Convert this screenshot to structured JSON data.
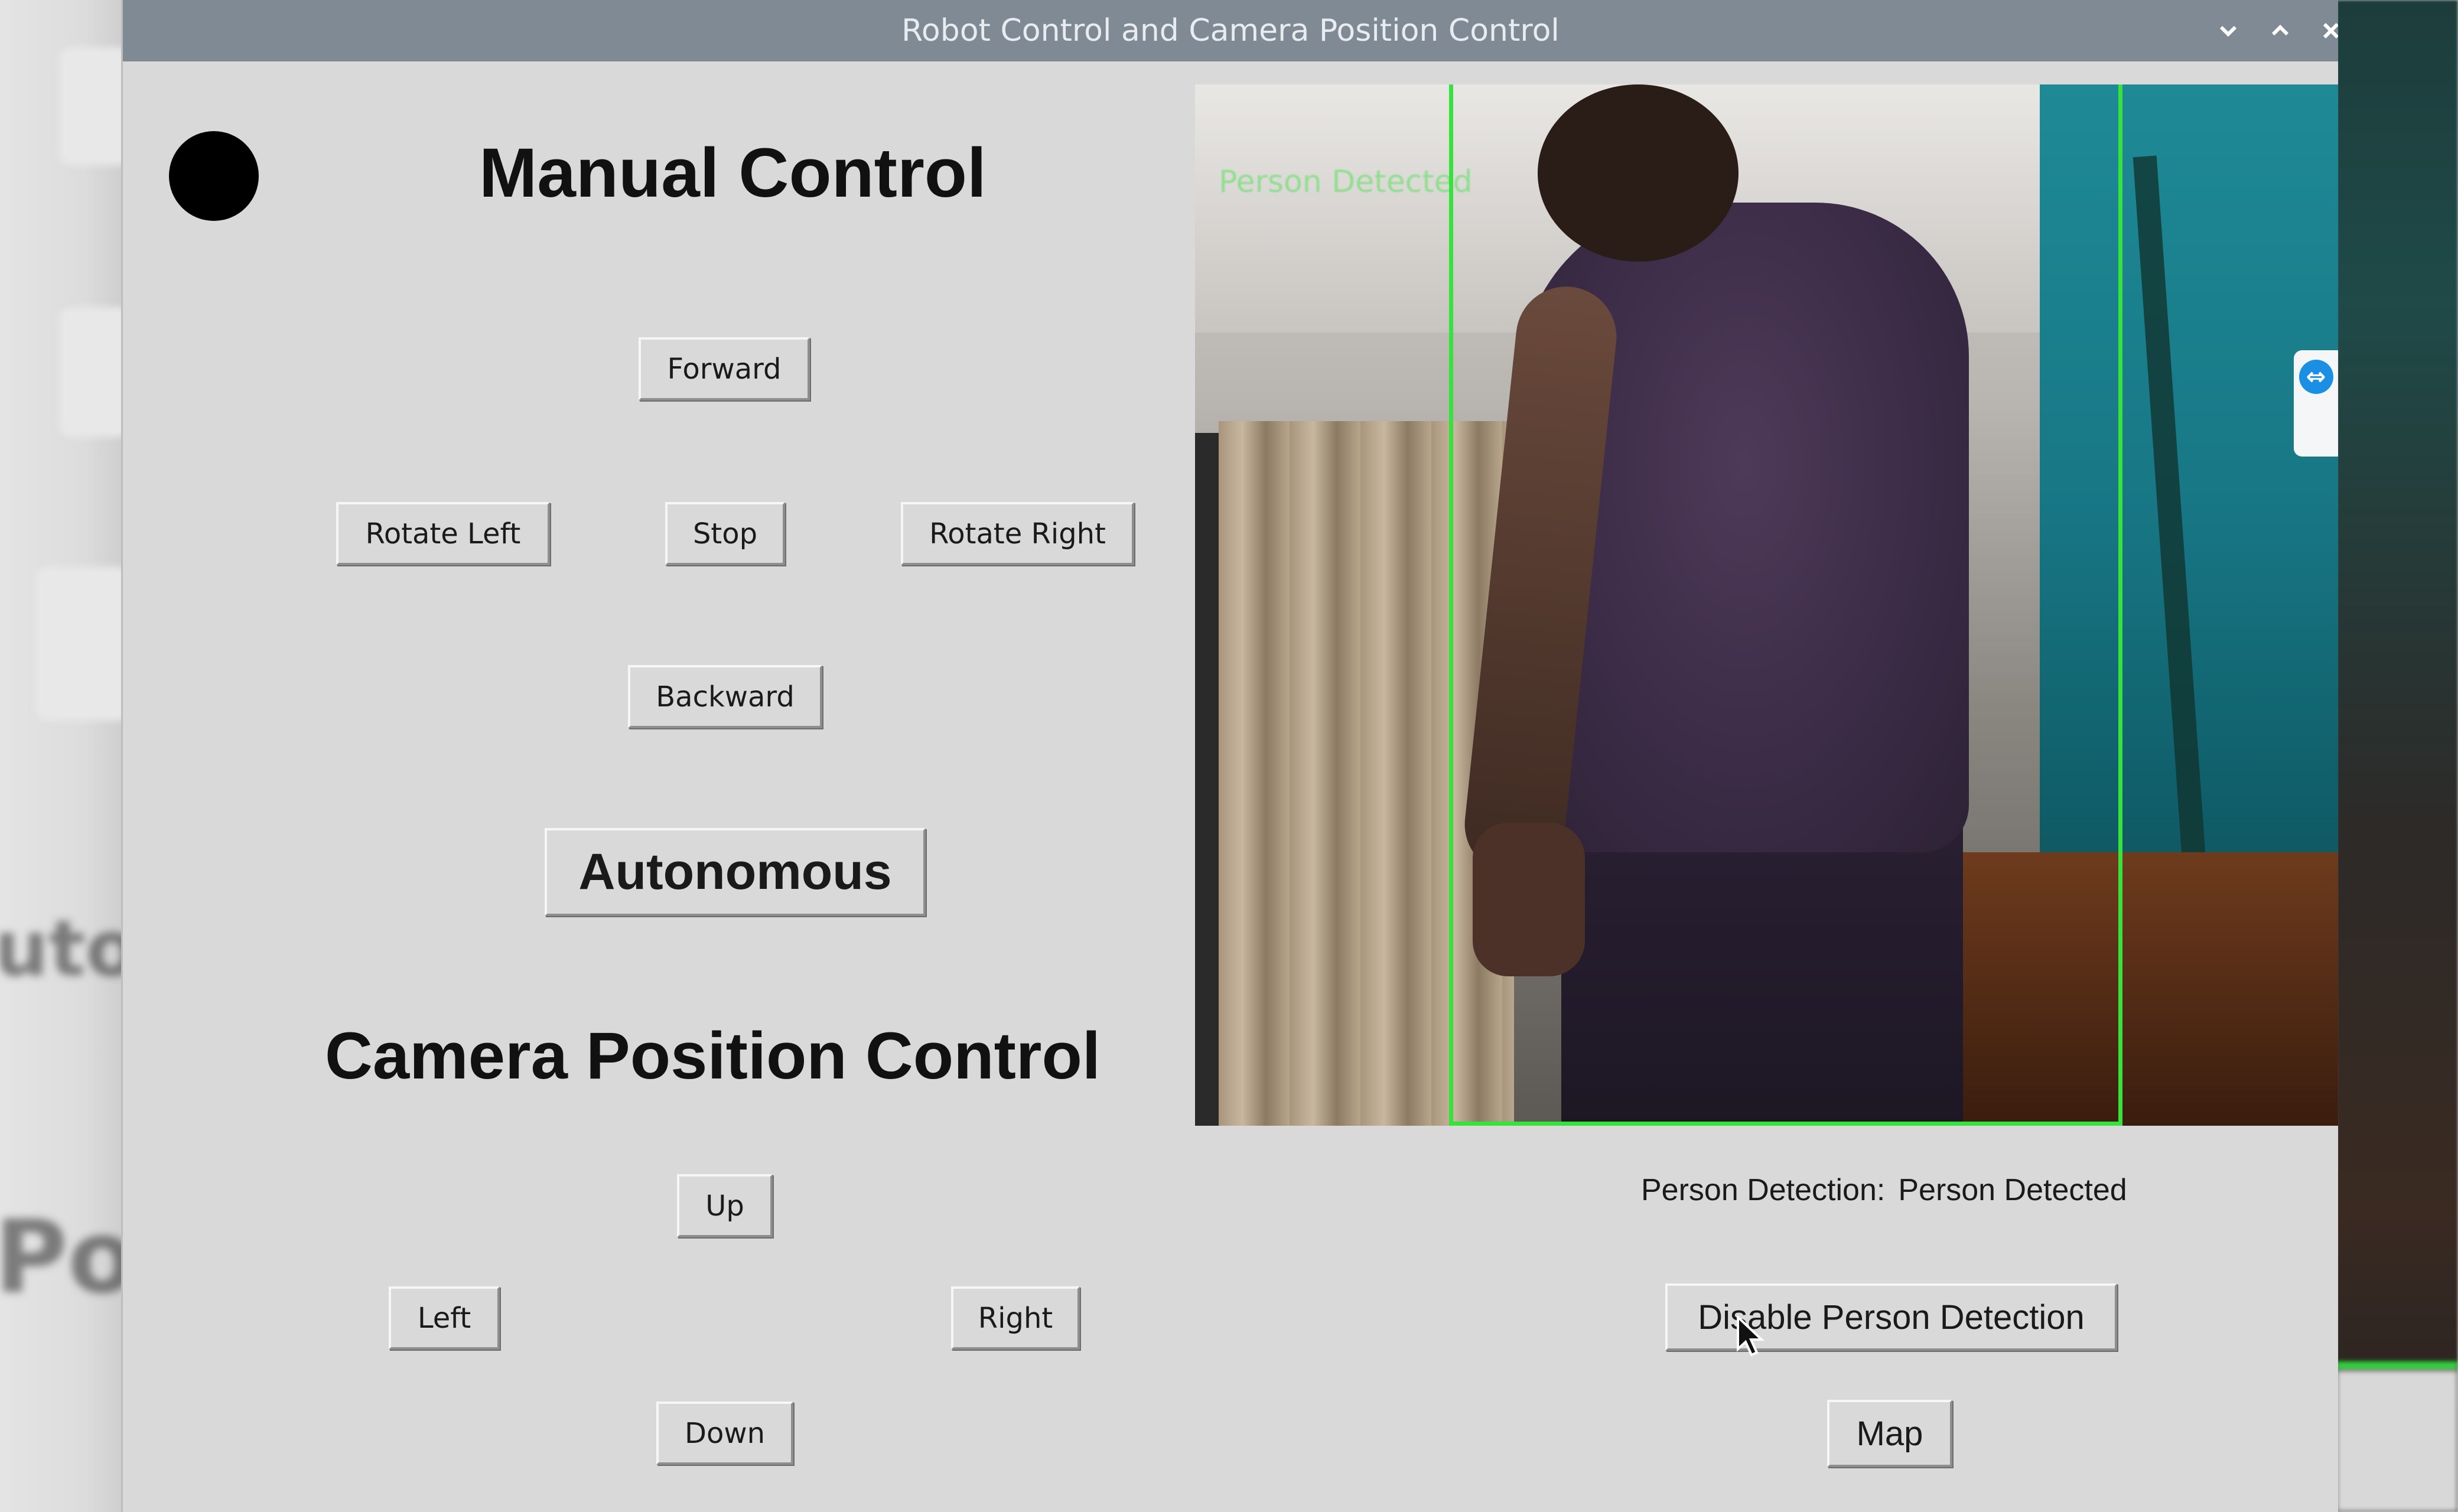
{
  "window": {
    "title": "Robot Control and Camera Position Control",
    "controls": {
      "minimize_icon": "chevron-down-icon",
      "maximize_icon": "chevron-up-icon",
      "close_icon": "close-icon"
    }
  },
  "manual_control": {
    "heading": "Manual Control",
    "status_indicator_color": "#000000",
    "buttons": {
      "forward": "Forward",
      "rotate_left": "Rotate Left",
      "stop": "Stop",
      "rotate_right": "Rotate Right",
      "backward": "Backward"
    },
    "autonomous_button": "Autonomous"
  },
  "camera_position_control": {
    "heading": "Camera Position Control",
    "buttons": {
      "up": "Up",
      "left": "Left",
      "right": "Right",
      "down": "Down"
    }
  },
  "camera_feed": {
    "overlay_label": "Person Detected",
    "bounding_box_color": "#38e23c"
  },
  "person_detection": {
    "label": "Person Detection:",
    "value": "Person Detected",
    "toggle_button": "Disable Person Detection"
  },
  "map_button": "Map",
  "colors": {
    "window_bg": "#d9d9d9",
    "titlebar_bg": "#7f8a95",
    "detection_green": "#38e23c"
  }
}
